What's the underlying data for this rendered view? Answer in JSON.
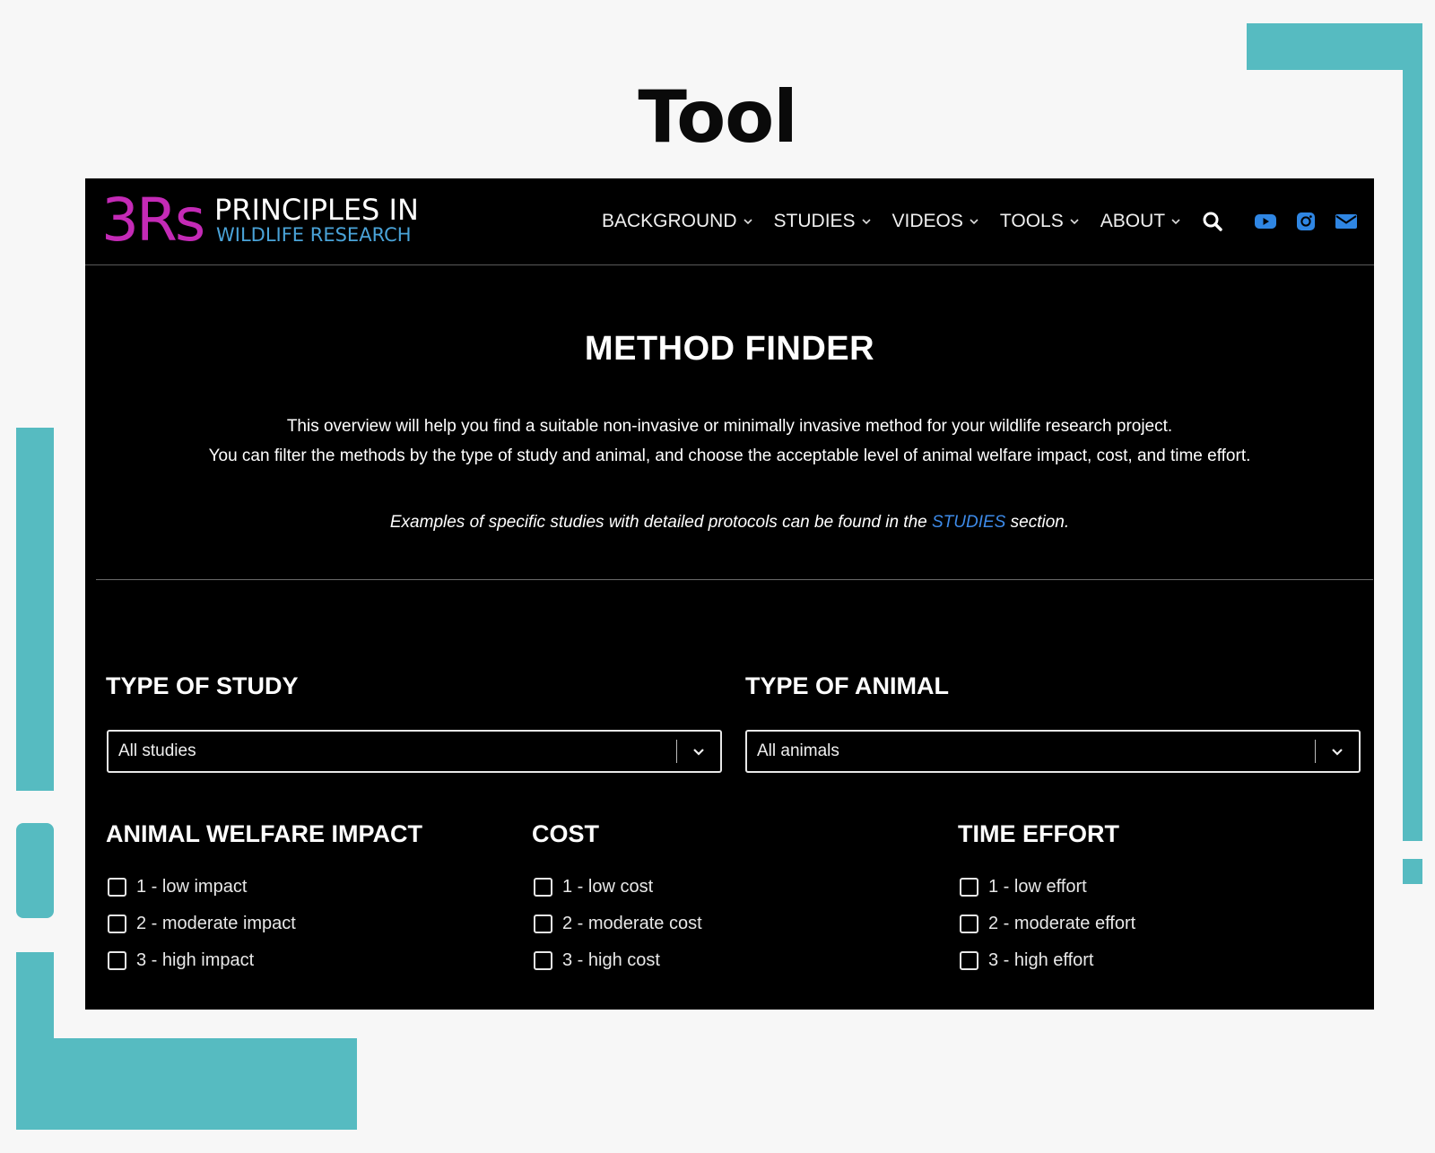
{
  "slide": {
    "title": "Tool"
  },
  "site": {
    "logo": {
      "mark": "3Rs",
      "line1": "PRINCIPLES IN",
      "line2": "WILDLIFE RESEARCH"
    },
    "nav": [
      {
        "label": "BACKGROUND"
      },
      {
        "label": "STUDIES"
      },
      {
        "label": "VIDEOS"
      },
      {
        "label": "TOOLS"
      },
      {
        "label": "ABOUT"
      }
    ],
    "icons": [
      "search-icon",
      "youtube-icon",
      "instagram-icon",
      "mail-icon"
    ],
    "colors": {
      "accent_blue": "#3d8ae8",
      "logo_magenta": "#c42ab6",
      "deco_teal": "#56bbc1"
    }
  },
  "hero": {
    "title": "METHOD FINDER",
    "p1": "This overview will help you find a suitable non-invasive or minimally invasive method for your wildlife research project.",
    "p2": "You can filter the methods by the type of study and animal, and choose the acceptable level of animal welfare impact, cost, and time effort.",
    "p3_before": "Examples of specific studies with detailed protocols can be found in the ",
    "p3_link": "STUDIES",
    "p3_after": " section."
  },
  "filters": {
    "study": {
      "heading": "TYPE OF STUDY",
      "selected": "All studies"
    },
    "animal": {
      "heading": "TYPE OF ANIMAL",
      "selected": "All animals"
    },
    "welfare": {
      "heading": "ANIMAL WELFARE IMPACT",
      "options": [
        "1 - low impact",
        "2 - moderate impact",
        "3 - high impact"
      ]
    },
    "cost": {
      "heading": "COST",
      "options": [
        "1 - low cost",
        "2 - moderate cost",
        "3 - high cost"
      ]
    },
    "time": {
      "heading": "TIME EFFORT",
      "options": [
        "1 - low effort",
        "2 - moderate effort",
        "3 - high effort"
      ]
    }
  }
}
